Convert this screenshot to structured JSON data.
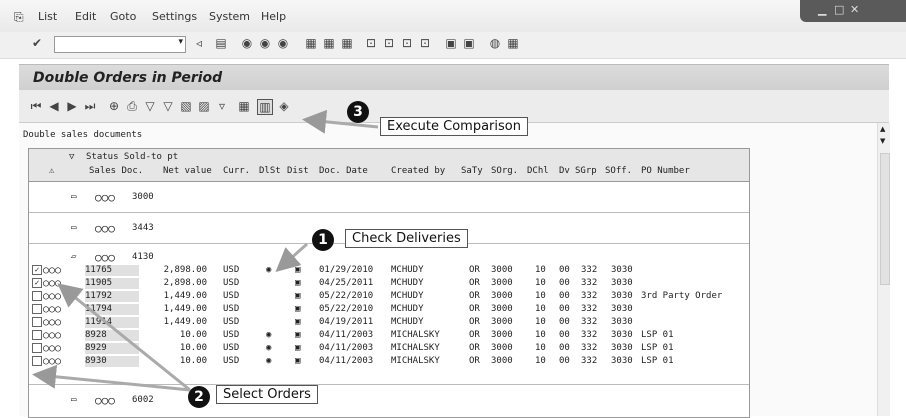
{
  "menu": [
    {
      "label": "List"
    },
    {
      "label": "Edit"
    },
    {
      "label": "Goto"
    },
    {
      "label": "Settings"
    },
    {
      "label": "System"
    },
    {
      "label": "Help"
    }
  ],
  "window": {
    "title": "Double Orders in Period"
  },
  "subtitle": "Double sales documents",
  "header": {
    "line1": "Status Sold-to pt",
    "cols": [
      "Sales Doc.",
      "Net value",
      "Curr.",
      "DlSt",
      "Dist",
      "Doc. Date",
      "Created by",
      "SaTy",
      "SOrg.",
      "DChl",
      "Dv",
      "SGrp",
      "SOff.",
      "PO Number"
    ]
  },
  "groups": [
    {
      "soldto": "3000"
    },
    {
      "soldto": "3443"
    },
    {
      "soldto": "4130"
    },
    {
      "soldto": "6002"
    }
  ],
  "rows": [
    {
      "checked": true,
      "doc": "11765",
      "net": "2,898.00",
      "curr": "USD",
      "dlst": "dot",
      "dist": "sq",
      "date": "01/29/2010",
      "by": "MCHUDY",
      "saty": "OR",
      "sorg": "3000",
      "dchl": "10",
      "dv": "00",
      "sgrp": "332",
      "soff": "3030",
      "po": ""
    },
    {
      "checked": true,
      "doc": "11905",
      "net": "2,898.00",
      "curr": "USD",
      "dlst": "",
      "dist": "sq",
      "date": "04/25/2011",
      "by": "MCHUDY",
      "saty": "OR",
      "sorg": "3000",
      "dchl": "10",
      "dv": "00",
      "sgrp": "332",
      "soff": "3030",
      "po": ""
    },
    {
      "checked": false,
      "doc": "11792",
      "net": "1,449.00",
      "curr": "USD",
      "dlst": "",
      "dist": "sq",
      "date": "05/22/2010",
      "by": "MCHUDY",
      "saty": "OR",
      "sorg": "3000",
      "dchl": "10",
      "dv": "00",
      "sgrp": "332",
      "soff": "3030",
      "po": "3rd Party Order"
    },
    {
      "checked": false,
      "doc": "11794",
      "net": "1,449.00",
      "curr": "USD",
      "dlst": "",
      "dist": "sq",
      "date": "05/22/2010",
      "by": "MCHUDY",
      "saty": "OR",
      "sorg": "3000",
      "dchl": "10",
      "dv": "00",
      "sgrp": "332",
      "soff": "3030",
      "po": ""
    },
    {
      "checked": false,
      "doc": "11914",
      "net": "1,449.00",
      "curr": "USD",
      "dlst": "",
      "dist": "sq",
      "date": "04/19/2011",
      "by": "MCHUDY",
      "saty": "OR",
      "sorg": "3000",
      "dchl": "10",
      "dv": "00",
      "sgrp": "332",
      "soff": "3030",
      "po": ""
    },
    {
      "checked": false,
      "doc": "8928",
      "net": "10.00",
      "curr": "USD",
      "dlst": "dot",
      "dist": "sq",
      "date": "04/11/2003",
      "by": "MICHALSKY",
      "saty": "OR",
      "sorg": "3000",
      "dchl": "10",
      "dv": "00",
      "sgrp": "332",
      "soff": "3030",
      "po": "LSP 01"
    },
    {
      "checked": false,
      "doc": "8929",
      "net": "10.00",
      "curr": "USD",
      "dlst": "dot",
      "dist": "sq",
      "date": "04/11/2003",
      "by": "MICHALSKY",
      "saty": "OR",
      "sorg": "3000",
      "dchl": "10",
      "dv": "00",
      "sgrp": "332",
      "soff": "3030",
      "po": "LSP 01"
    },
    {
      "checked": false,
      "doc": "8930",
      "net": "10.00",
      "curr": "USD",
      "dlst": "dot",
      "dist": "sq",
      "date": "04/11/2003",
      "by": "MICHALSKY",
      "saty": "OR",
      "sorg": "3000",
      "dchl": "10",
      "dv": "00",
      "sgrp": "332",
      "soff": "3030",
      "po": "LSP 01"
    }
  ],
  "callouts": {
    "c1": {
      "num": "1",
      "text": "Check Deliveries"
    },
    "c2": {
      "num": "2",
      "text": "Select Orders"
    },
    "c3": {
      "num": "3",
      "text": "Execute Comparison"
    }
  }
}
